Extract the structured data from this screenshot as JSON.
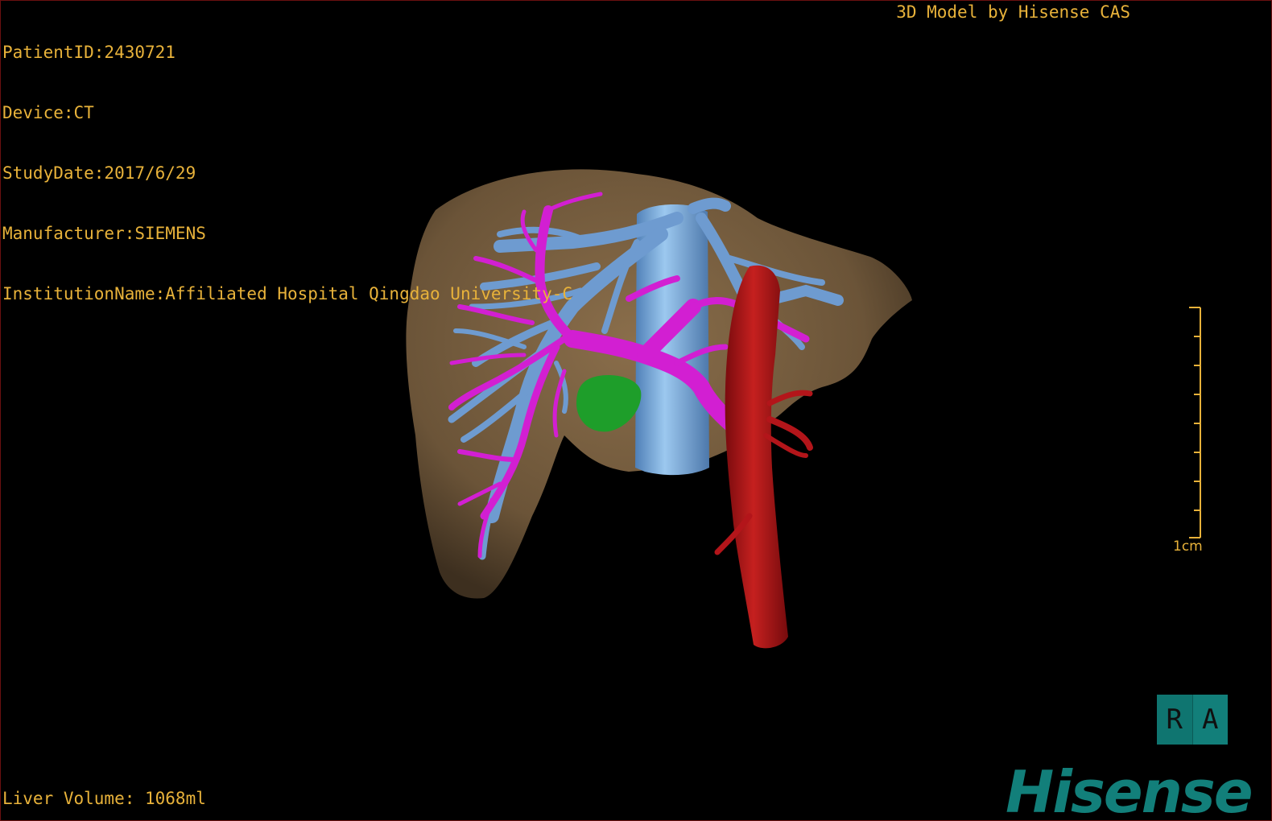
{
  "overlay": {
    "patient_id": "PatientID:2430721",
    "device": "Device:CT",
    "study_date": "StudyDate:2017/6/29",
    "manufacturer": "Manufacturer:SIEMENS",
    "institution": "InstitutionName:Affiliated Hospital Qingdao University-C",
    "credit": "3D Model by Hisense CAS",
    "liver_volume": "Liver Volume: 1068ml"
  },
  "scale_bar": {
    "label": "1cm"
  },
  "orientation_cube": {
    "left_face": "R",
    "right_face": "A"
  },
  "brand": {
    "logo_text": "Hisense"
  },
  "colors": {
    "overlay_text": "#e8b23a",
    "liver": "#8a6e4b",
    "hepatic_vein": "#6e9bd0",
    "portal_vein": "#d21fd2",
    "artery_aorta": "#b3151a",
    "gallbladder": "#1e9e2a",
    "brand": "#127f7a"
  }
}
